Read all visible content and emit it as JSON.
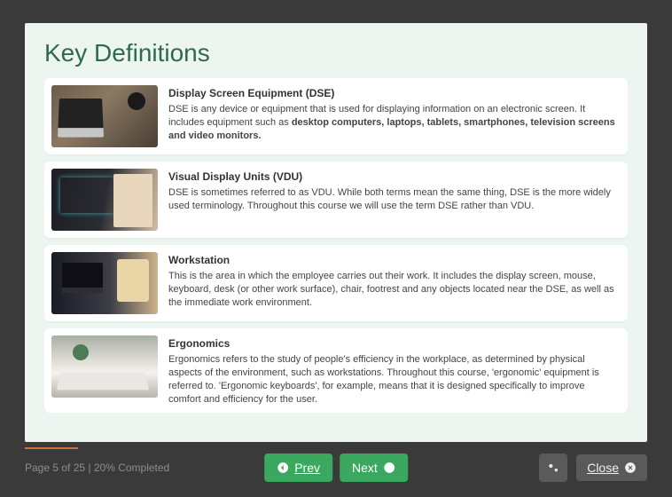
{
  "page": {
    "title": "Key Definitions"
  },
  "cards": [
    {
      "thumb_class": "laptop",
      "title": "Display Screen Equipment (DSE)",
      "body_pre": "DSE is any device or equipment that is used for displaying information on an electronic screen. It includes equipment such as ",
      "body_bold": "desktop computers, laptops, tablets, smartphones, television screens and video monitors.",
      "body_post": ""
    },
    {
      "thumb_class": "vdu",
      "title": "Visual Display Units (VDU)",
      "body_pre": "DSE is sometimes referred to as VDU. While both terms mean the same thing, DSE is the more widely used terminology. Throughout this course we will use the term DSE rather than VDU.",
      "body_bold": "",
      "body_post": ""
    },
    {
      "thumb_class": "workstation",
      "title": "Workstation",
      "body_pre": "This is the area in which the employee carries out their work. It includes the display screen, mouse, keyboard, desk (or other work surface), chair, footrest and any objects located near the DSE, as well as the immediate work environment.",
      "body_bold": "",
      "body_post": ""
    },
    {
      "thumb_class": "office",
      "title": "Ergonomics",
      "body_pre": "Ergonomics refers to the study of people's efficiency in the workplace, as determined by physical aspects of the environment, such as workstations. Throughout this course, 'ergonomic' equipment is referred to. 'Ergonomic keyboards', for example, means that it is designed specifically to improve comfort and efficiency for the user.",
      "body_bold": "",
      "body_post": ""
    }
  ],
  "footer": {
    "status": "Page 5 of 25 | 20% Completed",
    "prev_label": "Prev",
    "next_label": "Next",
    "close_label": "Close"
  }
}
